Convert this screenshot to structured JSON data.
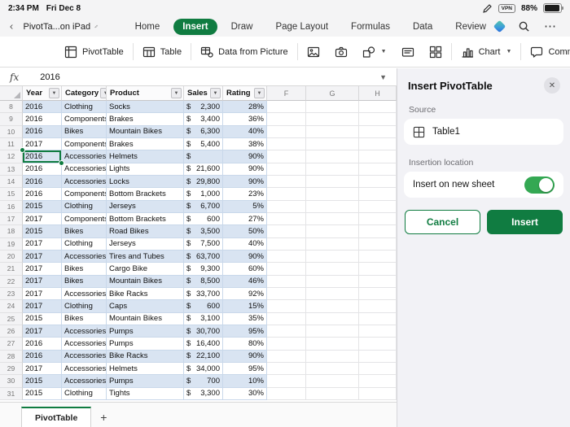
{
  "status_bar": {
    "time": "2:34 PM",
    "date": "Fri Dec 8",
    "vpn": "VPN",
    "battery": "88%"
  },
  "title_bar": {
    "title": "PivotTa...on iPad",
    "tabs": [
      "Home",
      "Insert",
      "Draw",
      "Page Layout",
      "Formulas",
      "Data",
      "Review"
    ],
    "active_tab": "Insert",
    "top_icons": [
      "copilot",
      "search",
      "more"
    ]
  },
  "ribbon": {
    "pivot_table": "PivotTable",
    "table": "Table",
    "data_from_picture": "Data from Picture",
    "chart": "Chart",
    "comment": "Comment",
    "tool_icons": [
      "picture",
      "camera",
      "shapes",
      "text-box",
      "apps"
    ]
  },
  "formula_bar": {
    "value": "2016"
  },
  "grid": {
    "columns": [
      "Year",
      "Category",
      "Product",
      "Sales",
      "Rating"
    ],
    "extra_columns": [
      "F",
      "G",
      "H"
    ],
    "selected": {
      "row": 12,
      "col": "year"
    },
    "rows": [
      {
        "n": 8,
        "year": "2016",
        "category": "Clothing",
        "product": "Socks",
        "sales": "2,300",
        "rating": "28%"
      },
      {
        "n": 9,
        "year": "2016",
        "category": "Components",
        "product": "Brakes",
        "sales": "3,400",
        "rating": "36%"
      },
      {
        "n": 10,
        "year": "2016",
        "category": "Bikes",
        "product": "Mountain Bikes",
        "sales": "6,300",
        "rating": "40%"
      },
      {
        "n": 11,
        "year": "2017",
        "category": "Components",
        "product": "Brakes",
        "sales": "5,400",
        "rating": "38%"
      },
      {
        "n": 12,
        "year": "2016",
        "category": "Accessories",
        "product": "Helmets",
        "sales": "",
        "rating": "90%"
      },
      {
        "n": 13,
        "year": "2016",
        "category": "Accessories",
        "product": "Lights",
        "sales": "21,600",
        "rating": "90%"
      },
      {
        "n": 14,
        "year": "2016",
        "category": "Accessories",
        "product": "Locks",
        "sales": "29,800",
        "rating": "90%"
      },
      {
        "n": 15,
        "year": "2016",
        "category": "Components",
        "product": "Bottom Brackets",
        "sales": "1,000",
        "rating": "23%"
      },
      {
        "n": 16,
        "year": "2015",
        "category": "Clothing",
        "product": "Jerseys",
        "sales": "6,700",
        "rating": "5%"
      },
      {
        "n": 17,
        "year": "2017",
        "category": "Components",
        "product": "Bottom Brackets",
        "sales": "600",
        "rating": "27%"
      },
      {
        "n": 18,
        "year": "2015",
        "category": "Bikes",
        "product": "Road Bikes",
        "sales": "3,500",
        "rating": "50%"
      },
      {
        "n": 19,
        "year": "2017",
        "category": "Clothing",
        "product": "Jerseys",
        "sales": "7,500",
        "rating": "40%"
      },
      {
        "n": 20,
        "year": "2017",
        "category": "Accessories",
        "product": "Tires and Tubes",
        "sales": "63,700",
        "rating": "90%"
      },
      {
        "n": 21,
        "year": "2017",
        "category": "Bikes",
        "product": "Cargo Bike",
        "sales": "9,300",
        "rating": "60%"
      },
      {
        "n": 22,
        "year": "2017",
        "category": "Bikes",
        "product": "Mountain Bikes",
        "sales": "8,500",
        "rating": "46%"
      },
      {
        "n": 23,
        "year": "2017",
        "category": "Accessories",
        "product": "Bike Racks",
        "sales": "33,700",
        "rating": "92%"
      },
      {
        "n": 24,
        "year": "2017",
        "category": "Clothing",
        "product": "Caps",
        "sales": "600",
        "rating": "15%"
      },
      {
        "n": 25,
        "year": "2015",
        "category": "Bikes",
        "product": "Mountain Bikes",
        "sales": "3,100",
        "rating": "35%"
      },
      {
        "n": 26,
        "year": "2017",
        "category": "Accessories",
        "product": "Pumps",
        "sales": "30,700",
        "rating": "95%"
      },
      {
        "n": 27,
        "year": "2016",
        "category": "Accessories",
        "product": "Pumps",
        "sales": "16,400",
        "rating": "80%"
      },
      {
        "n": 28,
        "year": "2016",
        "category": "Accessories",
        "product": "Bike Racks",
        "sales": "22,100",
        "rating": "90%"
      },
      {
        "n": 29,
        "year": "2017",
        "category": "Accessories",
        "product": "Helmets",
        "sales": "34,000",
        "rating": "95%"
      },
      {
        "n": 30,
        "year": "2015",
        "category": "Accessories",
        "product": "Pumps",
        "sales": "700",
        "rating": "10%"
      },
      {
        "n": 31,
        "year": "2015",
        "category": "Clothing",
        "product": "Tights",
        "sales": "3,300",
        "rating": "30%"
      }
    ]
  },
  "panel": {
    "title": "Insert PivotTable",
    "source_label": "Source",
    "source_value": "Table1",
    "location_label": "Insertion location",
    "toggle_label": "Insert on new sheet",
    "toggle_on": true,
    "cancel_label": "Cancel",
    "insert_label": "Insert"
  },
  "sheet_bar": {
    "tab": "PivotTable",
    "add": "+"
  },
  "colors": {
    "excel_green": "#107C41",
    "toggle_green": "#34A853",
    "band_blue": "#D9E4F2",
    "selection_green": "#107C41"
  }
}
